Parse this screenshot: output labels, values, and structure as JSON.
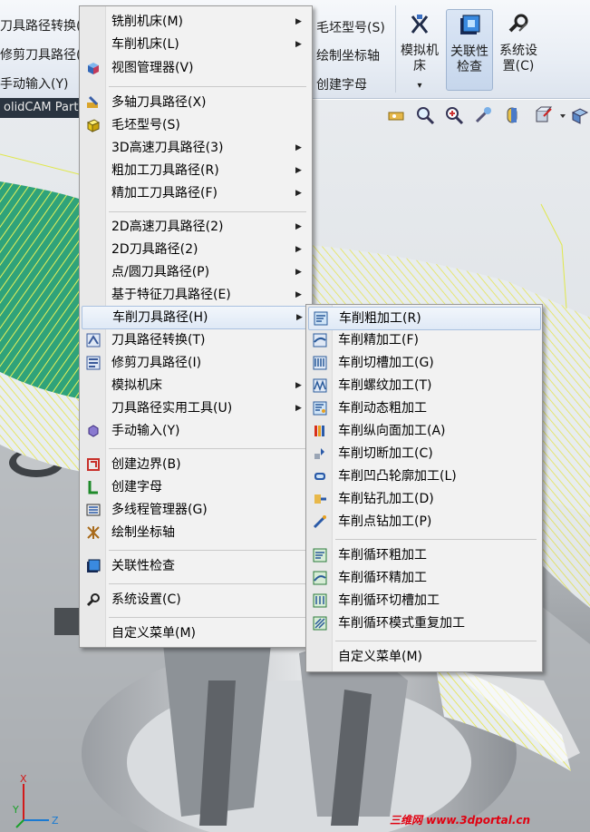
{
  "ribbon": {
    "left_items": [
      "刀具路径转换(",
      "修剪刀具路径(",
      "手动输入(Y)"
    ],
    "mid_items": [
      "毛坯型号(S)",
      "绘制坐标轴",
      "创建字母"
    ],
    "buttons": [
      {
        "label": "模拟机床",
        "icon": "simulate-machine-icon"
      },
      {
        "label": "关联性检查",
        "icon": "associativity-check-icon",
        "active": true
      },
      {
        "label": "系统设置(C)",
        "icon": "system-settings-icon"
      }
    ],
    "dropdown_glyph": "▾"
  },
  "part_tab": "olidCAM Part",
  "main_menu": {
    "items": [
      {
        "label": "铣削机床(M)",
        "icon": "",
        "submenu": true
      },
      {
        "label": "车削机床(L)",
        "icon": "",
        "submenu": true
      },
      {
        "label": "视图管理器(V)",
        "icon": "view-manager-icon",
        "submenu": false
      },
      {
        "label": "多轴刀具路径(X)",
        "icon": "multiaxis-toolpath-icon",
        "submenu": false
      },
      {
        "label": "毛坯型号(S)",
        "icon": "stock-model-icon",
        "submenu": false
      },
      {
        "label": "3D高速刀具路径(3)",
        "icon": "",
        "submenu": true
      },
      {
        "label": "粗加工刀具路径(R)",
        "icon": "",
        "submenu": true
      },
      {
        "label": "精加工刀具路径(F)",
        "icon": "",
        "submenu": true
      },
      {
        "label": "2D高速刀具路径(2)",
        "icon": "",
        "submenu": true
      },
      {
        "label": "2D刀具路径(2)",
        "icon": "",
        "submenu": true
      },
      {
        "label": "点/圆刀具路径(P)",
        "icon": "",
        "submenu": true
      },
      {
        "label": "基于特征刀具路径(E)",
        "icon": "",
        "submenu": true
      },
      {
        "label": "车削刀具路径(H)",
        "icon": "",
        "submenu": true,
        "highlighted": true
      },
      {
        "label": "刀具路径转换(T)",
        "icon": "toolpath-transform-icon",
        "submenu": false
      },
      {
        "label": "修剪刀具路径(I)",
        "icon": "trim-toolpath-icon",
        "submenu": false
      },
      {
        "label": "模拟机床",
        "icon": "",
        "submenu": true
      },
      {
        "label": "刀具路径实用工具(U)",
        "icon": "",
        "submenu": true
      },
      {
        "label": "手动输入(Y)",
        "icon": "manual-entry-icon",
        "submenu": false
      },
      {
        "label": "创建边界(B)",
        "icon": "create-boundary-icon",
        "submenu": false
      },
      {
        "label": "创建字母",
        "icon": "create-letters-icon",
        "submenu": false
      },
      {
        "label": "多线程管理器(G)",
        "icon": "multithread-manager-icon",
        "submenu": false
      },
      {
        "label": "绘制坐标轴",
        "icon": "draw-axes-icon",
        "submenu": false
      },
      {
        "label": "关联性检查",
        "icon": "associativity-check-icon",
        "submenu": false
      },
      {
        "label": "系统设置(C)",
        "icon": "system-settings-icon",
        "submenu": false
      },
      {
        "label": "自定义菜单(M)",
        "icon": "",
        "submenu": false
      }
    ]
  },
  "lathe_submenu": {
    "items": [
      {
        "label": "车削粗加工(R)",
        "icon": "lathe-rough-icon",
        "highlighted": true
      },
      {
        "label": "车削精加工(F)",
        "icon": "lathe-finish-icon"
      },
      {
        "label": "车削切槽加工(G)",
        "icon": "lathe-groove-icon"
      },
      {
        "label": "车削螺纹加工(T)",
        "icon": "lathe-thread-icon"
      },
      {
        "label": "车削动态粗加工",
        "icon": "lathe-dynamic-rough-icon"
      },
      {
        "label": "车削纵向面加工(A)",
        "icon": "lathe-face-icon"
      },
      {
        "label": "车削切断加工(C)",
        "icon": "lathe-cutoff-icon"
      },
      {
        "label": "车削凹凸轮廓加工(L)",
        "icon": "lathe-contour-icon"
      },
      {
        "label": "车削钻孔加工(D)",
        "icon": "lathe-drill-icon"
      },
      {
        "label": "车削点钻加工(P)",
        "icon": "lathe-spot-drill-icon"
      },
      {
        "label": "车削循环粗加工",
        "icon": "lathe-canned-rough-icon"
      },
      {
        "label": "车削循环精加工",
        "icon": "lathe-canned-finish-icon"
      },
      {
        "label": "车削循环切槽加工",
        "icon": "lathe-canned-groove-icon"
      },
      {
        "label": "车削循环模式重复加工",
        "icon": "lathe-canned-pattern-icon"
      },
      {
        "label": "自定义菜单(M)",
        "icon": ""
      }
    ]
  },
  "submenu_arrow": "▶",
  "axis_labels": {
    "x": "X",
    "y": "Y",
    "z": "Z"
  },
  "watermark": "三维网 www.3dportal.cn"
}
